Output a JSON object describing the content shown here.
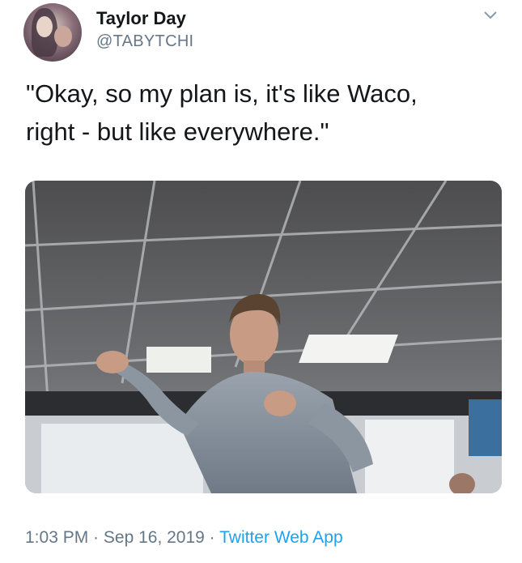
{
  "tweet": {
    "author_name": "Taylor Day",
    "author_handle": "@TABYTCHI",
    "text_line1": "\"Okay, so my plan is, it's like Waco,",
    "text_line2": "right - but like everywhere.\"",
    "time": "1:03 PM",
    "separator": " · ",
    "date": "Sep 16, 2019",
    "source": "Twitter Web App"
  },
  "icons": {
    "menu": "chevron-down-icon",
    "avatar": "profile-photo"
  },
  "colors": {
    "text": "#14171a",
    "secondary": "#657786",
    "link": "#1da1f2"
  }
}
